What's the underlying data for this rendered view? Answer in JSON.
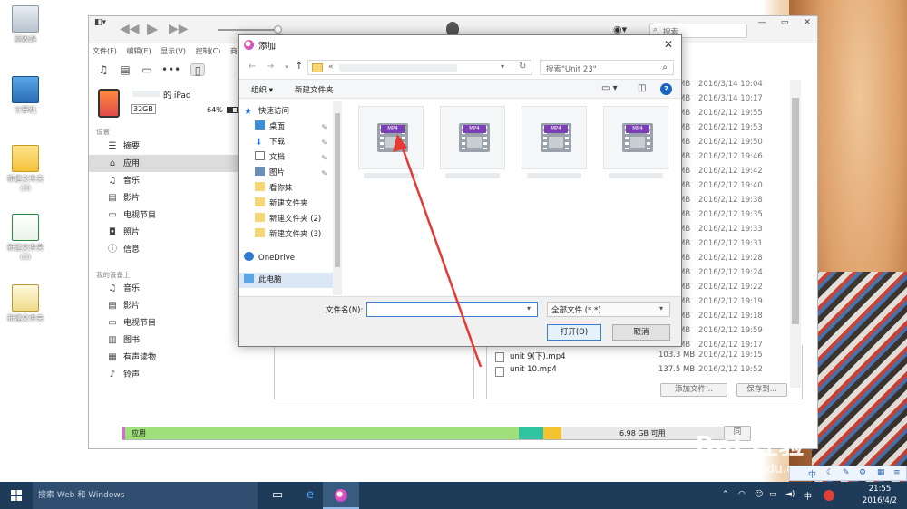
{
  "desktop": {
    "icons": [
      {
        "label": "回收站",
        "icon": "recycle-bin-icon"
      },
      {
        "label": "计算机",
        "icon": "computer-icon"
      },
      {
        "label": "新建文件夹\n(3)",
        "icon": "folder-icon"
      },
      {
        "label": "新建文件夹\n(2)",
        "icon": "excel-file-icon"
      },
      {
        "label": "新建文件夹",
        "icon": "document-folder-icon"
      }
    ]
  },
  "itunes": {
    "search_placeholder": "搜索",
    "menu": [
      "文件(F)",
      "编辑(E)",
      "显示(V)",
      "控制(C)",
      "商"
    ],
    "device": {
      "name": "的 iPad",
      "capacity": "32GB",
      "battery": "64%"
    },
    "sidebar": {
      "settings_header": "设置",
      "settings_items": [
        {
          "label": "摘要",
          "icon": "summary-icon"
        },
        {
          "label": "应用",
          "icon": "apps-icon"
        },
        {
          "label": "音乐",
          "icon": "music-note-icon"
        },
        {
          "label": "影片",
          "icon": "film-icon"
        },
        {
          "label": "电视节目",
          "icon": "tv-icon"
        },
        {
          "label": "照片",
          "icon": "camera-icon"
        },
        {
          "label": "信息",
          "icon": "info-icon"
        }
      ],
      "device_header": "我的设备上",
      "device_items": [
        {
          "label": "音乐",
          "icon": "music-note-icon"
        },
        {
          "label": "影片",
          "icon": "film-icon"
        },
        {
          "label": "电视节目",
          "icon": "tv-icon"
        },
        {
          "label": "图书",
          "icon": "book-icon"
        },
        {
          "label": "有声读物",
          "icon": "audiobook-icon"
        },
        {
          "label": "铃声",
          "icon": "bell-icon"
        }
      ]
    },
    "file_list_bg": [
      {
        "size": "MB",
        "date": "2016/3/14 10:04"
      },
      {
        "size": "MB",
        "date": "2016/3/14 10:17"
      },
      {
        "size": "MB",
        "date": "2016/2/12 19:55"
      },
      {
        "size": "MB",
        "date": "2016/2/12 19:53"
      },
      {
        "size": "MB",
        "date": "2016/2/12 19:50"
      },
      {
        "size": "MB",
        "date": "2016/2/12 19:46"
      },
      {
        "size": "MB",
        "date": "2016/2/12 19:42"
      },
      {
        "size": "MB",
        "date": "2016/2/12 19:40"
      },
      {
        "size": "MB",
        "date": "2016/2/12 19:38"
      },
      {
        "size": "MB",
        "date": "2016/2/12 19:35"
      },
      {
        "size": "MB",
        "date": "2016/2/12 19:33"
      },
      {
        "size": "MB",
        "date": "2016/2/12 19:31"
      },
      {
        "size": "MB",
        "date": "2016/2/12 19:28"
      },
      {
        "size": "MB",
        "date": "2016/2/12 19:24"
      },
      {
        "size": "MB",
        "date": "2016/2/12 19:22"
      },
      {
        "size": "MB",
        "date": "2016/2/12 19:19"
      },
      {
        "size": "MB",
        "date": "2016/2/12 19:18"
      },
      {
        "size": "MB",
        "date": "2016/2/12 19:59"
      },
      {
        "size": "MB",
        "date": "2016/2/12 19:17"
      }
    ],
    "file_list_visible": [
      {
        "name": "unit 9(下).mp4",
        "size": "103.3 MB",
        "date": "2016/2/12 19:15"
      },
      {
        "name": "unit 10.mp4",
        "size": "137.5 MB",
        "date": "2016/2/12 19:52"
      }
    ],
    "add_file_label": "添加文件...",
    "save_to_label": "保存到...",
    "storage": {
      "app_label": "应用",
      "free_label": "6.98 GB 可用",
      "sync_label": "同"
    }
  },
  "dialog": {
    "title": "添加",
    "address_prefix": "«",
    "search_placeholder": "搜索\"Unit 23\"",
    "organize_label": "组织 ▾",
    "new_folder_label": "新建文件夹",
    "nav_items": [
      {
        "label": "快速访问",
        "icon": "star-icon",
        "pinned": false
      },
      {
        "label": "桌面",
        "icon": "desktop-icon",
        "pinned": true
      },
      {
        "label": "下载",
        "icon": "download-icon",
        "pinned": true
      },
      {
        "label": "文档",
        "icon": "document-icon",
        "pinned": true
      },
      {
        "label": "图片",
        "icon": "picture-icon",
        "pinned": true
      },
      {
        "label": "看你妹",
        "icon": "folder-icon",
        "pinned": false
      },
      {
        "label": "新建文件夹",
        "icon": "folder-icon",
        "pinned": false
      },
      {
        "label": "新建文件夹 (2)",
        "icon": "folder-icon",
        "pinned": false
      },
      {
        "label": "新建文件夹 (3)",
        "icon": "folder-icon",
        "pinned": false
      },
      {
        "label": "OneDrive",
        "icon": "onedrive-icon",
        "pinned": false
      },
      {
        "label": "此电脑",
        "icon": "this-pc-icon",
        "pinned": false
      }
    ],
    "tiles": [
      {
        "badge": "MP4"
      },
      {
        "badge": "MP4"
      },
      {
        "badge": "MP4"
      },
      {
        "badge": "MP4"
      }
    ],
    "filename_label": "文件名(N):",
    "filename_value": "",
    "filetype_value": "全部文件 (*.*)",
    "open_label": "打开(O)",
    "cancel_label": "取消"
  },
  "watermark": {
    "logo": "Bai 经验",
    "url": "jingyan.baidu.com"
  },
  "taskbar": {
    "search_placeholder": "搜索 Web 和 Windows",
    "time": "21:55",
    "date": "2016/4/2",
    "ime": "中"
  },
  "colors": {
    "storage_app": "#9fe07a",
    "storage_pink": "#e066d6",
    "storage_teal": "#2fc3a0",
    "storage_yellow": "#f4c430",
    "annotation_arrow": "#e53935",
    "taskbar": "#1e3b5a"
  }
}
